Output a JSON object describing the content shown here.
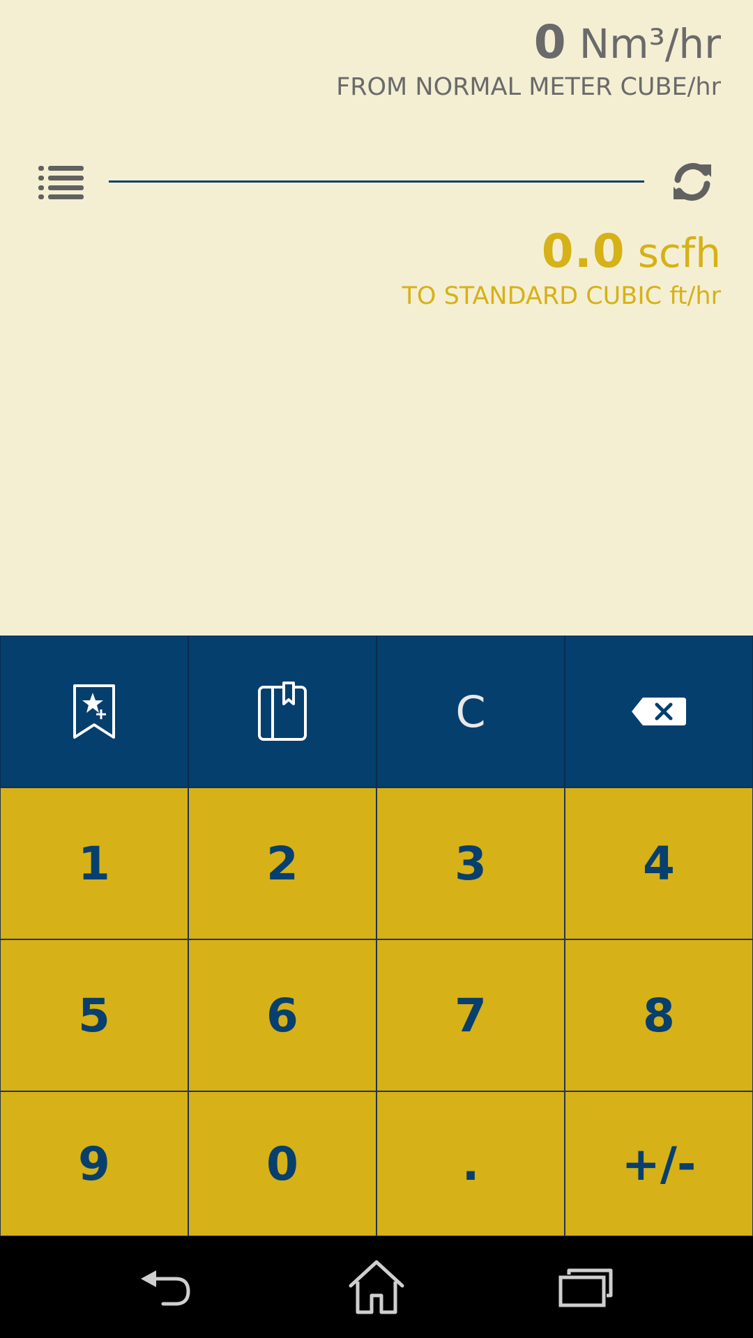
{
  "from": {
    "value": "0",
    "unit": "Nm³/hr",
    "description": "FROM NORMAL METER CUBE/hr"
  },
  "to": {
    "value": "0.0",
    "unit": "scfh",
    "description": "TO STANDARD CUBIC ft/hr"
  },
  "keypad": {
    "clear_label": "C",
    "keys": [
      "1",
      "2",
      "3",
      "4",
      "5",
      "6",
      "7",
      "8",
      "9",
      "0",
      ".",
      "+/-"
    ]
  },
  "colors": {
    "background": "#f4efd3",
    "primary_blue": "#053f6e",
    "accent_yellow": "#d6b117",
    "from_text": "#6a6a6a"
  },
  "icons": {
    "list": "list-icon",
    "swap": "swap-icon",
    "add_favorite": "bookmark-star-add-icon",
    "favorites": "book-bookmark-icon",
    "backspace": "backspace-icon",
    "back": "back-icon",
    "home": "home-icon",
    "recent": "recent-apps-icon"
  }
}
